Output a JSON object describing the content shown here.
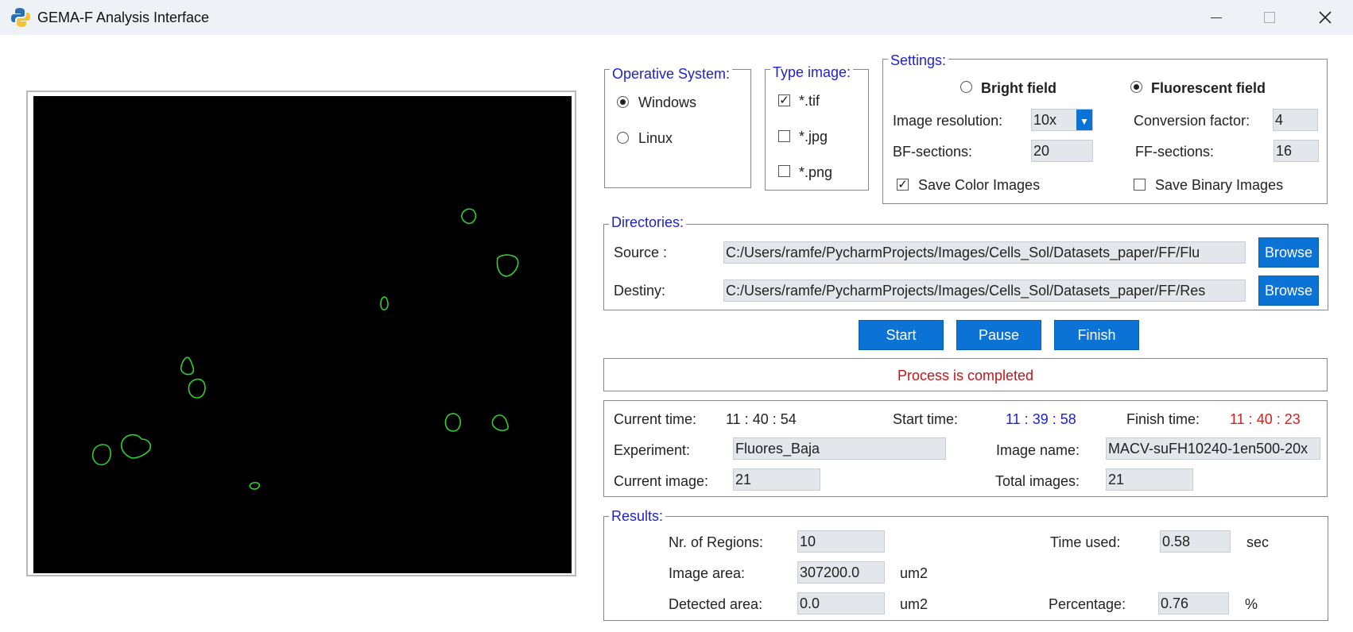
{
  "window": {
    "title": "GEMA-F Analysis Interface"
  },
  "os": {
    "legend": "Operative System:",
    "options": [
      "Windows",
      "Linux"
    ],
    "selected": "Windows"
  },
  "type_image": {
    "legend": "Type image:",
    "options": [
      {
        "label": "*.tif",
        "checked": true
      },
      {
        "label": "*.jpg",
        "checked": false
      },
      {
        "label": "*.png",
        "checked": false
      }
    ]
  },
  "settings": {
    "legend": "Settings:",
    "bright_field": "Bright field",
    "fluorescent_field": "Fluorescent field",
    "selected_field": "Fluorescent field",
    "image_resolution_label": "Image resolution:",
    "image_resolution_value": "10x",
    "conversion_factor_label": "Conversion factor:",
    "conversion_factor_value": "4",
    "bf_sections_label": "BF-sections:",
    "bf_sections_value": "20",
    "ff_sections_label": "FF-sections:",
    "ff_sections_value": "16",
    "save_color_label": "Save Color Images",
    "save_color_checked": true,
    "save_binary_label": "Save Binary Images",
    "save_binary_checked": false
  },
  "directories": {
    "legend": "Directories:",
    "source_label": "Source :",
    "source_value": "C:/Users/ramfe/PycharmProjects/Images/Cells_Sol/Datasets_paper/FF/Flu",
    "destiny_label": "Destiny:",
    "destiny_value": "C:/Users/ramfe/PycharmProjects/Images/Cells_Sol/Datasets_paper/FF/Res",
    "browse_label": "Browse"
  },
  "controls": {
    "start": "Start",
    "pause": "Pause",
    "finish": "Finish"
  },
  "status": {
    "message": "Process is completed",
    "color": "#c0161b"
  },
  "info": {
    "current_time_label": "Current time:",
    "current_time": "11 : 40 : 54",
    "start_time_label": "Start time:",
    "start_time": "11 : 39 : 58",
    "start_time_color": "#1f1fd1",
    "finish_time_label": "Finish time:",
    "finish_time": "11 : 40 : 23",
    "finish_time_color": "#e01b1b",
    "experiment_label": "Experiment:",
    "experiment_value": "Fluores_Baja",
    "image_name_label": "Image name:",
    "image_name_value": "MACV-suFH10240-1en500-20x",
    "current_image_label": "Current image:",
    "current_image_value": "21",
    "total_images_label": "Total images:",
    "total_images_value": "21"
  },
  "results": {
    "legend": "Results:",
    "regions_label": "Nr. of Regions:",
    "regions_value": "10",
    "image_area_label": "Image area:",
    "image_area_value": "307200.0",
    "image_area_unit": "um2",
    "detected_area_label": "Detected area:",
    "detected_area_value": "0.0",
    "detected_area_unit": "um2",
    "time_used_label": "Time used:",
    "time_used_value": "0.58",
    "time_used_unit": "sec",
    "percentage_label": "Percentage:",
    "percentage_value": "0.76",
    "percentage_unit": "%"
  },
  "icons": {
    "app": "python-icon",
    "minimize": "minimize-icon",
    "maximize": "maximize-icon",
    "close": "close-icon",
    "dropdown": "chevron-down-icon"
  },
  "colors": {
    "accent": "#0b72d6",
    "legend": "#1f1fd1",
    "contour": "#2fd02f"
  }
}
